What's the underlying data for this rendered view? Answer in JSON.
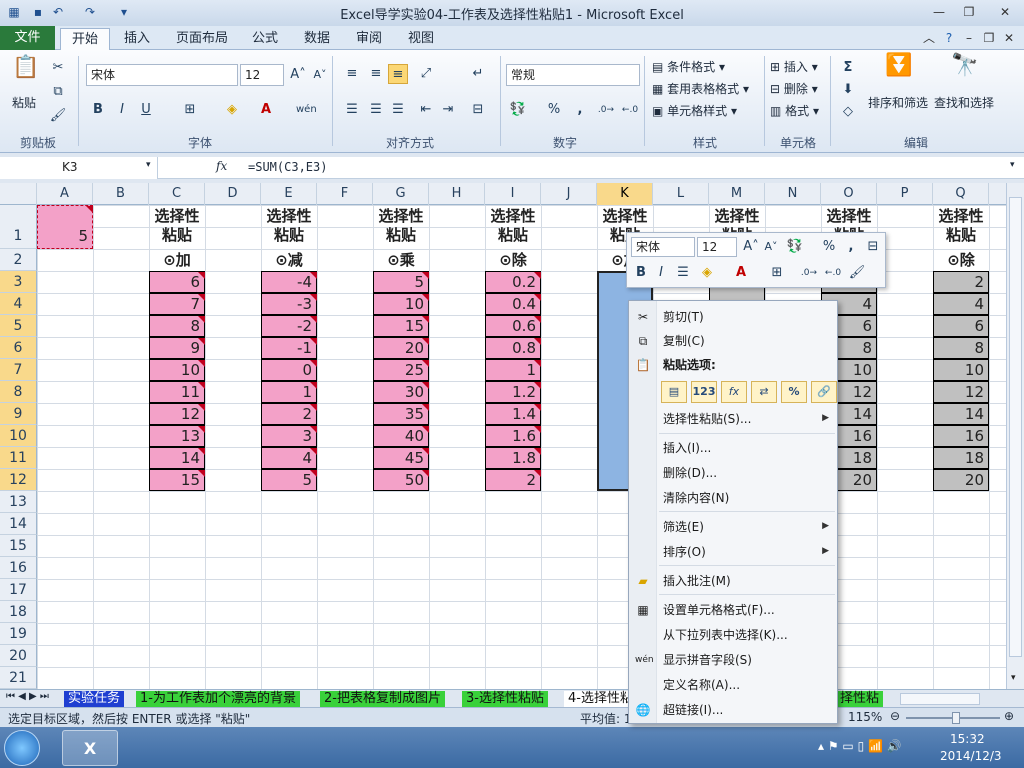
{
  "window": {
    "title": "Excel导学实验04-工作表及选择性粘贴1  -  Microsoft Excel"
  },
  "tabs": [
    "文件",
    "开始",
    "插入",
    "页面布局",
    "公式",
    "数据",
    "审阅",
    "视图"
  ],
  "ribbon": {
    "clipboard": {
      "paste": "粘贴",
      "label": "剪贴板"
    },
    "font": {
      "name": "宋体",
      "size": "12",
      "label": "字体",
      "bold": "B",
      "italic": "I",
      "underline": "U"
    },
    "alignment": {
      "label": "对齐方式"
    },
    "number": {
      "format": "常规",
      "label": "数字",
      "percent": "%",
      "comma": ","
    },
    "styles": {
      "conditional": "条件格式",
      "table": "套用表格格式",
      "cell": "单元格样式",
      "label": "样式"
    },
    "cells": {
      "insert": "插入",
      "delete": "删除",
      "format": "格式",
      "label": "单元格"
    },
    "editing": {
      "sort": "排序和筛选",
      "find": "查找和选择",
      "label": "编辑"
    }
  },
  "formula_bar": {
    "name_box": "K3",
    "fx": "fx",
    "formula": "=SUM(C3,E3)"
  },
  "columns": [
    "A",
    "B",
    "C",
    "D",
    "E",
    "F",
    "G",
    "H",
    "I",
    "J",
    "K",
    "L",
    "M",
    "N",
    "O",
    "P",
    "Q"
  ],
  "rows": [
    "1",
    "2",
    "3",
    "4",
    "5",
    "6",
    "7",
    "8",
    "9",
    "10",
    "11",
    "12",
    "13",
    "14",
    "15",
    "16",
    "17",
    "18",
    "19",
    "20",
    "21"
  ],
  "cells": {
    "A1": "5",
    "headers": [
      "选择性",
      "粘贴"
    ],
    "ops": {
      "C": "⊙加",
      "E": "⊙减",
      "G": "⊙乘",
      "I": "⊙除",
      "K": "⊙加",
      "Q": "⊙除"
    },
    "C": [
      "6",
      "7",
      "8",
      "9",
      "10",
      "11",
      "12",
      "13",
      "14",
      "15"
    ],
    "E": [
      "-4",
      "-3",
      "-2",
      "-1",
      "0",
      "1",
      "2",
      "3",
      "4",
      "5"
    ],
    "G": [
      "5",
      "10",
      "15",
      "20",
      "25",
      "30",
      "35",
      "40",
      "45",
      "50"
    ],
    "I": [
      "0.2",
      "0.4",
      "0.6",
      "0.8",
      "1",
      "1.2",
      "1.4",
      "1.6",
      "1.8",
      "2"
    ],
    "O": [
      "2",
      "4",
      "6",
      "8",
      "10",
      "12",
      "14",
      "16",
      "18",
      "20"
    ],
    "Q": [
      "2",
      "4",
      "6",
      "8",
      "10",
      "12",
      "14",
      "16",
      "18",
      "20"
    ]
  },
  "mini_toolbar": {
    "font": "宋体",
    "size": "12",
    "percent": "%",
    "comma": ","
  },
  "context_menu": {
    "cut": "剪切(T)",
    "copy": "复制(C)",
    "paste_options": "粘贴选项:",
    "paste_special": "选择性粘贴(S)...",
    "insert": "插入(I)...",
    "delete": "删除(D)...",
    "clear": "清除内容(N)",
    "filter": "筛选(E)",
    "sort": "排序(O)",
    "comment": "插入批注(M)",
    "format_cells": "设置单元格格式(F)...",
    "pick_list": "从下拉列表中选择(K)...",
    "phonetic": "显示拼音字段(S)",
    "define_name": "定义名称(A)...",
    "hyperlink": "超链接(I)..."
  },
  "sheet_tabs": [
    "实验任务",
    "1-为工作表加个漂亮的背景",
    "2-把表格复制成图片",
    "3-选择性粘贴",
    "4-选择性粘",
    "择性粘"
  ],
  "status": {
    "message": "选定目标区域，然后按 ENTER 或选择 \"粘贴\"",
    "avg": "平均值: 1",
    "zoom": "115%"
  },
  "taskbar": {
    "time": "15:32",
    "date": "2014/12/3"
  },
  "colors": {
    "file_tab": "#2a7a3b",
    "pink": "#f3a1c8",
    "gray": "#c0c0c0",
    "selected": "#8db4e2"
  }
}
